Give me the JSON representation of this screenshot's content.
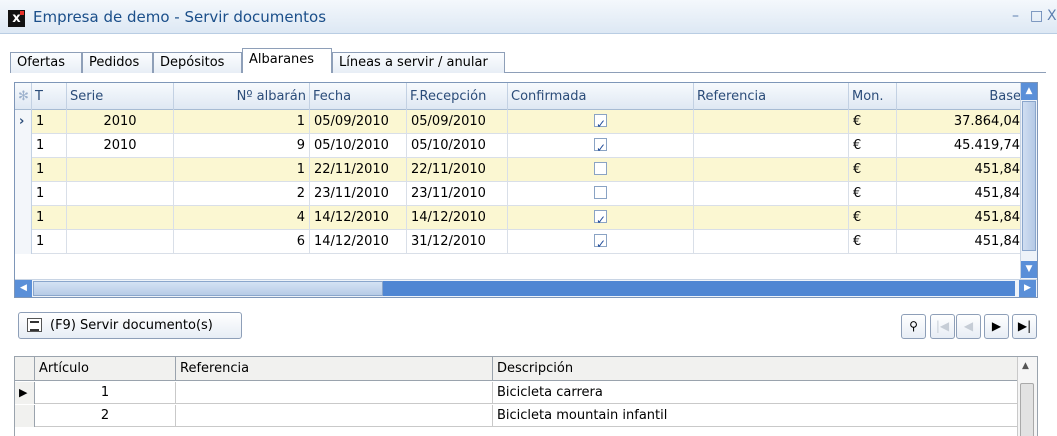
{
  "window": {
    "title": "Empresa de demo - Servir documentos",
    "minimize": "–",
    "maximize": "□",
    "close": "X"
  },
  "tabs": [
    "Ofertas",
    "Pedidos",
    "Depósitos",
    "Albaranes",
    "Líneas a servir / anular"
  ],
  "active_tab": "Albaranes",
  "grid": {
    "columns": [
      "T",
      "Serie",
      "Nº albarán",
      "Fecha",
      "F.Recepción",
      "Confirmada",
      "Referencia",
      "Mon.",
      "Base"
    ],
    "rows": [
      {
        "t": "1",
        "serie": "2010",
        "num": "1",
        "fecha": "05/09/2010",
        "frecepcion": "05/09/2010",
        "confirmada": true,
        "referencia": "",
        "mon": "€",
        "base": "37.864,04",
        "selected": true
      },
      {
        "t": "1",
        "serie": "2010",
        "num": "9",
        "fecha": "05/10/2010",
        "frecepcion": "05/10/2010",
        "confirmada": true,
        "referencia": "",
        "mon": "€",
        "base": "45.419,74",
        "selected": false
      },
      {
        "t": "1",
        "serie": "",
        "num": "1",
        "fecha": "22/11/2010",
        "frecepcion": "22/11/2010",
        "confirmada": false,
        "referencia": "",
        "mon": "€",
        "base": "451,84",
        "selected": false
      },
      {
        "t": "1",
        "serie": "",
        "num": "2",
        "fecha": "23/11/2010",
        "frecepcion": "23/11/2010",
        "confirmada": false,
        "referencia": "",
        "mon": "€",
        "base": "451,84",
        "selected": false
      },
      {
        "t": "1",
        "serie": "",
        "num": "4",
        "fecha": "14/12/2010",
        "frecepcion": "14/12/2010",
        "confirmada": true,
        "referencia": "",
        "mon": "€",
        "base": "451,84",
        "selected": false
      },
      {
        "t": "1",
        "serie": "",
        "num": "6",
        "fecha": "14/12/2010",
        "frecepcion": "31/12/2010",
        "confirmada": true,
        "referencia": "",
        "mon": "€",
        "base": "451,84",
        "selected": false
      }
    ]
  },
  "toolbar": {
    "serve_button": "(F9) Servir documento(s)"
  },
  "lines": {
    "columns": [
      "Artículo",
      "Referencia",
      "Descripción"
    ],
    "rows": [
      {
        "articulo": "1",
        "referencia": "",
        "descripcion": "Bicicleta carrera"
      },
      {
        "articulo": "2",
        "referencia": "",
        "descripcion": "Bicicleta mountain infantil"
      }
    ]
  }
}
